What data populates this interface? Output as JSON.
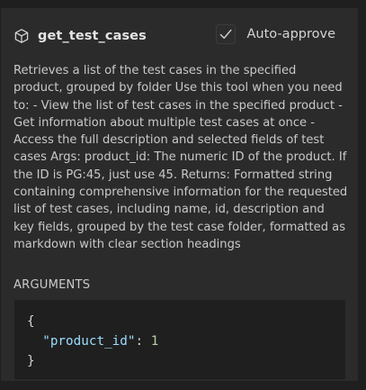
{
  "tool": {
    "icon": "package-icon",
    "name": "get_test_cases"
  },
  "auto_approve": {
    "label": "Auto-approve",
    "checked": true
  },
  "description": "Retrieves a list of the test cases in the specified product, grouped by folder Use this tool when you need to: - View the list of test cases in the specified product - Get information about multiple test cases at once - Access the full description and selected fields of test cases Args: product_id: The numeric ID of the product. If the ID is PG:45, just use 45. Returns: Formatted string containing comprehensive information for the requested list of test cases, including name, id, description and key fields, grouped by the test case folder, formatted as markdown with clear section headings",
  "arguments": {
    "label": "ARGUMENTS",
    "open_brace": "{",
    "key": "\"product_id\"",
    "colon": ": ",
    "value": "1",
    "close_brace": "}"
  },
  "colors": {
    "panel_bg": "#2b2b2b",
    "page_bg": "#1f1f1f",
    "json_key": "#9cdcfe",
    "json_number": "#b5cea8"
  }
}
